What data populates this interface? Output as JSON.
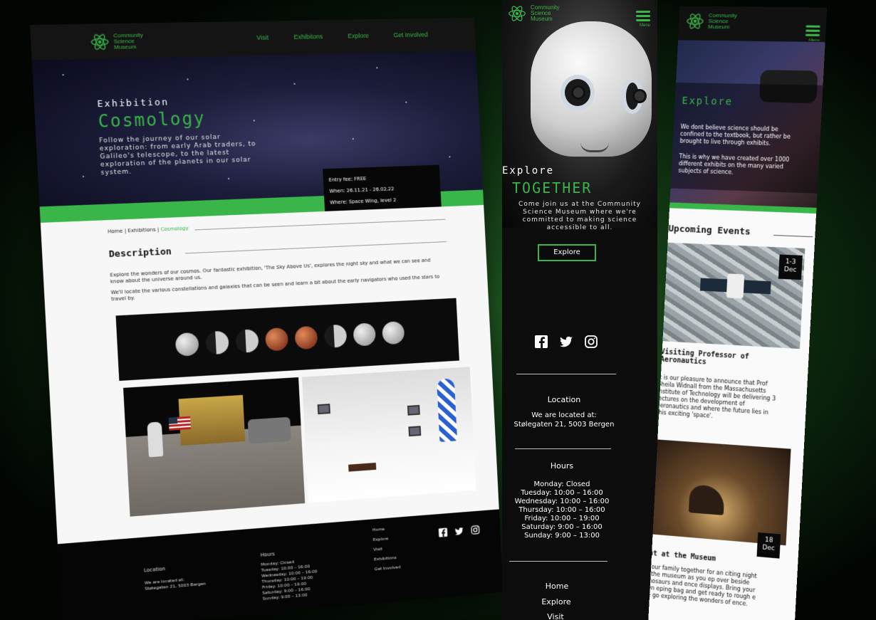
{
  "brand": {
    "name_line1": "Community",
    "name_line2": "Science",
    "name_line3": "Museum",
    "accent": "#39b54a"
  },
  "desktop": {
    "nav": [
      "Visit",
      "Exhibitons",
      "Explore",
      "Get Involved"
    ],
    "hero": {
      "kicker": "Exhibition",
      "title": "Cosmology",
      "lead": "Follow the journey of our solar exploration: from early Arab traders, to Galileo's telescope, to the latest exploration of the planets in our solar system."
    },
    "info": {
      "fee": "Entry fee: FREE",
      "when": "When: 26.11.21 - 26.02.22",
      "where": "Where: Space Wing, level 2"
    },
    "breadcrumb": {
      "home": "Home",
      "sep1": " | ",
      "exhibitions": "Exhibitions",
      "sep2": " | ",
      "current": "Cosmology"
    },
    "description": {
      "heading": "Description",
      "p1": "Explore the wonders of our cosmos. Our fantastic exhibition, 'The Sky Above Us', explores the night sky and what we can see and know about the universe around us.",
      "p2": "We'll locate the various constellations and galaxies that can be seen and learn a bit about the early navigators who used the stars to travel by."
    },
    "footer": {
      "location_heading": "Location",
      "location_text1": "We are located at:",
      "location_text2": "Stølegaten 21, 5003 Bergen",
      "hours_heading": "Hours",
      "hours": [
        "Monday: Closed",
        "Tuesday: 10:00 – 16:00",
        "Wednesday: 10:00 – 16:00",
        "Thursday: 10:00 – 19:00",
        "Friday: 10:00 – 19:00",
        "Saturday: 9:00 – 16:00",
        "Sunday: 9:00 – 13:00"
      ],
      "links": [
        "Home",
        "Explore",
        "Visit",
        "Exhibitions",
        "Get Involved"
      ]
    }
  },
  "mobile_home": {
    "menu_label": "Menu",
    "hero": {
      "kicker": "Explore",
      "title": "TOGETHER",
      "lead": "Come join us at the Community Science Museum where we're committed to making science accessible to all.",
      "button": "Explore"
    },
    "location_heading": "Location",
    "location_text1": "We are located at:",
    "location_text2": "Stølegaten 21, 5003 Bergen",
    "hours_heading": "Hours",
    "hours": [
      "Monday: Closed",
      "Tuesday: 10:00 – 16:00",
      "Wednesday: 10:00 – 16:00",
      "Thursday: 10:00 – 16:00",
      "Friday: 10:00 – 19:00",
      "Saturday: 9:00 – 16:00",
      "Sunday: 9:00 – 13:00"
    ],
    "links": [
      "Home",
      "Explore",
      "Visit"
    ]
  },
  "mobile_explore": {
    "menu_label": "Menu",
    "title": "Explore",
    "p1": "We dont believe science should be confined to the textbook, but rather be brought to live through exhibits.",
    "p2": "This is why we have created over 1000 different exhibits on the many varied subjects of science.",
    "upcoming_heading": "Upcoming Events",
    "events": [
      {
        "date_line1": "1-3",
        "date_line2": "Dec",
        "title": "Visiting Professor of Aeronautics",
        "text": "It is our pleasure to announce that Prof Sheila Widnall from the Massachusetts Institute of Technology will be delivering 3 lectures on the development of aeronautics and where the future lies in this exciting 'space'."
      },
      {
        "date_line1": "18",
        "date_line2": "Dec",
        "title": "ght at the Museum",
        "text": "t your family together for an citing night at the museum as you ep over beside dinosaurs and ence displays. Bring your own eping bag and get ready to rough e we go exploring the wonders of ence."
      }
    ]
  }
}
